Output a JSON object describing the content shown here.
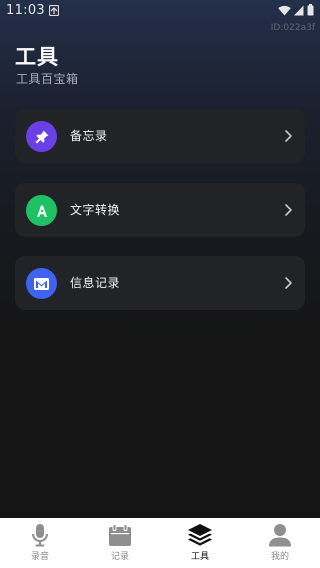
{
  "status_bar": {
    "time": "11:03",
    "device_id": "ID:022a3f"
  },
  "header": {
    "title": "工具",
    "subtitle": "工具百宝箱"
  },
  "tools": [
    {
      "label": "备忘录",
      "icon": "pin-icon",
      "color": "#6b3fe6"
    },
    {
      "label": "文字转换",
      "icon": "letter-a-icon",
      "color": "#1ec265"
    },
    {
      "label": "信息记录",
      "icon": "mail-icon",
      "color": "#3d63f0"
    }
  ],
  "tab_bar": {
    "tabs": [
      {
        "label": "录音",
        "icon": "microphone-icon",
        "active": false
      },
      {
        "label": "记录",
        "icon": "calendar-icon",
        "active": false
      },
      {
        "label": "工具",
        "icon": "layers-icon",
        "active": true
      },
      {
        "label": "我的",
        "icon": "person-icon",
        "active": false
      }
    ]
  },
  "colors": {
    "card_bg": "#222326",
    "tab_active": "#111111",
    "tab_inactive": "#8a8a8a"
  }
}
